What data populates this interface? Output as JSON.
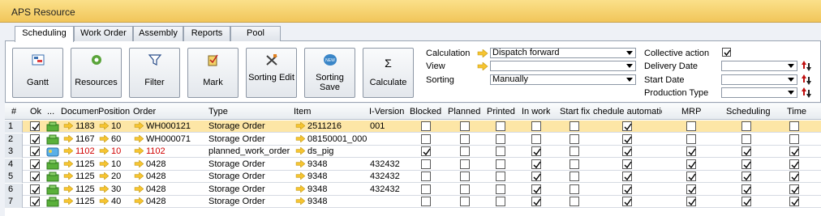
{
  "window": {
    "title": "APS Resource"
  },
  "tabs": [
    {
      "label": "Scheduling",
      "active": true
    },
    {
      "label": "Work Order",
      "active": false
    },
    {
      "label": "Assembly",
      "active": false
    },
    {
      "label": "Reports",
      "active": false
    },
    {
      "label": "Pool",
      "active": false
    }
  ],
  "toolbar": {
    "gantt": "Gantt",
    "resources": "Resources",
    "filter": "Filter",
    "mark": "Mark",
    "sorting_edit": "Sorting Edit",
    "sorting_save": "Sorting Save",
    "calculate": "Calculate",
    "calculate_symbol": "Σ",
    "new_badge": "NEW"
  },
  "options": {
    "calculation_label": "Calculation",
    "calculation_value": "Dispatch forward",
    "view_label": "View",
    "view_value": "",
    "sorting_label": "Sorting",
    "sorting_value": "Manually",
    "collective_label": "Collective action",
    "collective_checked": true,
    "delivery_label": "Delivery Date",
    "start_label": "Start Date",
    "production_label": "Production Type"
  },
  "columns": {
    "num": "#",
    "ok": "Ok",
    "dots": "...",
    "document": "Documen",
    "position": "Position",
    "order": "Order",
    "type": "Type",
    "item": "Item",
    "iversion": "I-Version",
    "blocked": "Blocked",
    "planned": "Planned",
    "printed": "Printed",
    "inwork": "In work",
    "startfix": "Start fix",
    "schedauto": "chedule automatica",
    "mrp": "MRP",
    "scheduling": "Scheduling",
    "time": "Time"
  },
  "rows": [
    {
      "n": "1",
      "doc": "1183",
      "pos": "10",
      "order": "WH000121",
      "type": "Storage Order",
      "item": "2511216",
      "iver": "001",
      "flags": [
        false,
        false,
        false,
        false,
        false,
        true,
        false,
        false,
        false
      ],
      "selected": true,
      "red": false,
      "ordLink": true
    },
    {
      "n": "2",
      "doc": "1167",
      "pos": "60",
      "order": "WH000071",
      "type": "Storage Order",
      "item": "08150001_000",
      "iver": "",
      "flags": [
        false,
        false,
        false,
        false,
        false,
        true,
        false,
        false,
        false
      ],
      "selected": false,
      "red": false,
      "ordLink": true
    },
    {
      "n": "3",
      "doc": "1102",
      "pos": "10",
      "order": "1102",
      "type": "planned_work_order",
      "item": "ds_pig",
      "iver": "",
      "flags": [
        true,
        false,
        false,
        true,
        false,
        true,
        true,
        true,
        true
      ],
      "selected": false,
      "red": true,
      "ordLink": true
    },
    {
      "n": "4",
      "doc": "1125",
      "pos": "10",
      "order": "0428",
      "type": "Storage Order",
      "item": "9348",
      "iver": "432432",
      "flags": [
        false,
        false,
        false,
        true,
        false,
        true,
        true,
        true,
        true
      ],
      "selected": false,
      "red": false,
      "ordLink": true
    },
    {
      "n": "5",
      "doc": "1125",
      "pos": "20",
      "order": "0428",
      "type": "Storage Order",
      "item": "9348",
      "iver": "432432",
      "flags": [
        false,
        false,
        false,
        true,
        false,
        true,
        true,
        true,
        true
      ],
      "selected": false,
      "red": false,
      "ordLink": true
    },
    {
      "n": "6",
      "doc": "1125",
      "pos": "30",
      "order": "0428",
      "type": "Storage Order",
      "item": "9348",
      "iver": "432432",
      "flags": [
        false,
        false,
        false,
        true,
        false,
        true,
        true,
        true,
        true
      ],
      "selected": false,
      "red": false,
      "ordLink": true
    },
    {
      "n": "7",
      "doc": "1125",
      "pos": "40",
      "order": "0428",
      "type": "Storage Order",
      "item": "9348",
      "iver": "",
      "flags": [
        false,
        false,
        false,
        true,
        false,
        true,
        true,
        true,
        true
      ],
      "selected": false,
      "red": false,
      "ordLink": true
    }
  ]
}
